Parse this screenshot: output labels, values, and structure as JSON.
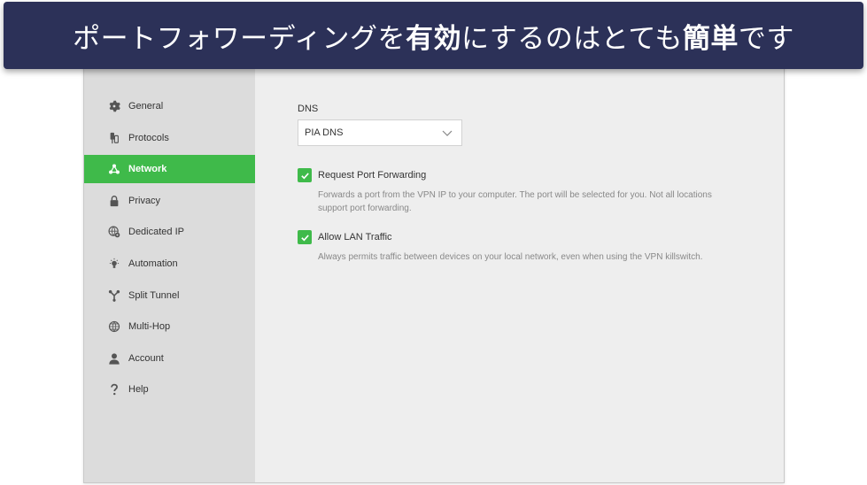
{
  "banner": {
    "text_before": "ポートフォワーディングを",
    "text_bold_1": "有効",
    "text_middle": "にするのはとても",
    "text_bold_2": "簡単",
    "text_after": "です"
  },
  "sidebar": {
    "items": [
      {
        "label": "General",
        "icon": "gear-icon",
        "active": false
      },
      {
        "label": "Protocols",
        "icon": "protocols-icon",
        "active": false
      },
      {
        "label": "Network",
        "icon": "network-icon",
        "active": true
      },
      {
        "label": "Privacy",
        "icon": "lock-icon",
        "active": false
      },
      {
        "label": "Dedicated IP",
        "icon": "dedicated-ip-icon",
        "active": false
      },
      {
        "label": "Automation",
        "icon": "lightbulb-icon",
        "active": false
      },
      {
        "label": "Split Tunnel",
        "icon": "split-tunnel-icon",
        "active": false
      },
      {
        "label": "Multi-Hop",
        "icon": "globe-icon",
        "active": false
      },
      {
        "label": "Account",
        "icon": "user-icon",
        "active": false
      },
      {
        "label": "Help",
        "icon": "question-icon",
        "active": false
      }
    ]
  },
  "network": {
    "dns_label": "DNS",
    "dns_value": "PIA DNS",
    "port_forwarding": {
      "title": "Request Port Forwarding",
      "checked": true,
      "description": "Forwards a port from the VPN IP to your computer. The port will be selected for you. Not all locations support port forwarding."
    },
    "lan_traffic": {
      "title": "Allow LAN Traffic",
      "checked": true,
      "description": "Always permits traffic between devices on your local network, even when using the VPN killswitch."
    }
  },
  "colors": {
    "accent": "#3fba4a",
    "banner_bg": "#2c3158",
    "sidebar_bg": "#dcdcdc",
    "main_bg": "#eeeeee"
  }
}
